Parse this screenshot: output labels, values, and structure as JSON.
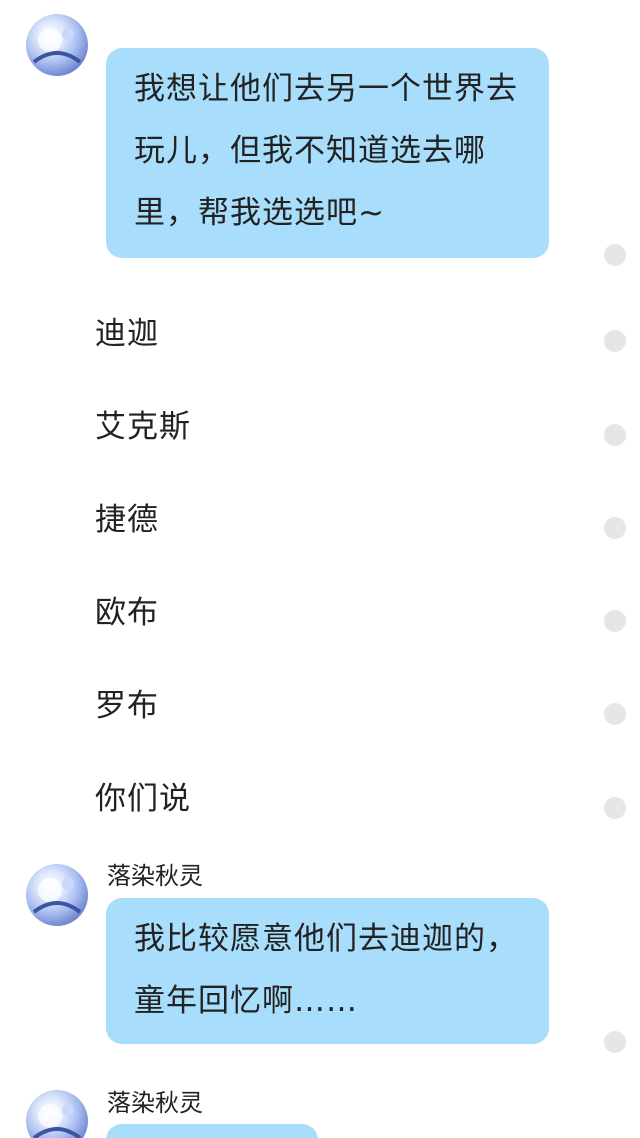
{
  "messages": [
    {
      "text": "我想让他们去另一个世界去玩儿，但我不知道选去哪里，帮我选选吧~"
    },
    {
      "text": "迪迦"
    },
    {
      "text": "艾克斯"
    },
    {
      "text": "捷德"
    },
    {
      "text": "欧布"
    },
    {
      "text": "罗布"
    },
    {
      "text": "你们说"
    },
    {
      "sender": "落染秋灵",
      "text": "我比较愿意他们去迪迦的，童年回忆啊……"
    },
    {
      "sender": "落染秋灵",
      "text": ""
    }
  ],
  "colors": {
    "bubble": "#a8defc",
    "text": "#222222",
    "read_dot": "#e6e6e6",
    "background": "#ffffff"
  },
  "icons": {
    "avatar": "anime-avatar-icon",
    "status": "read-status-dot"
  }
}
